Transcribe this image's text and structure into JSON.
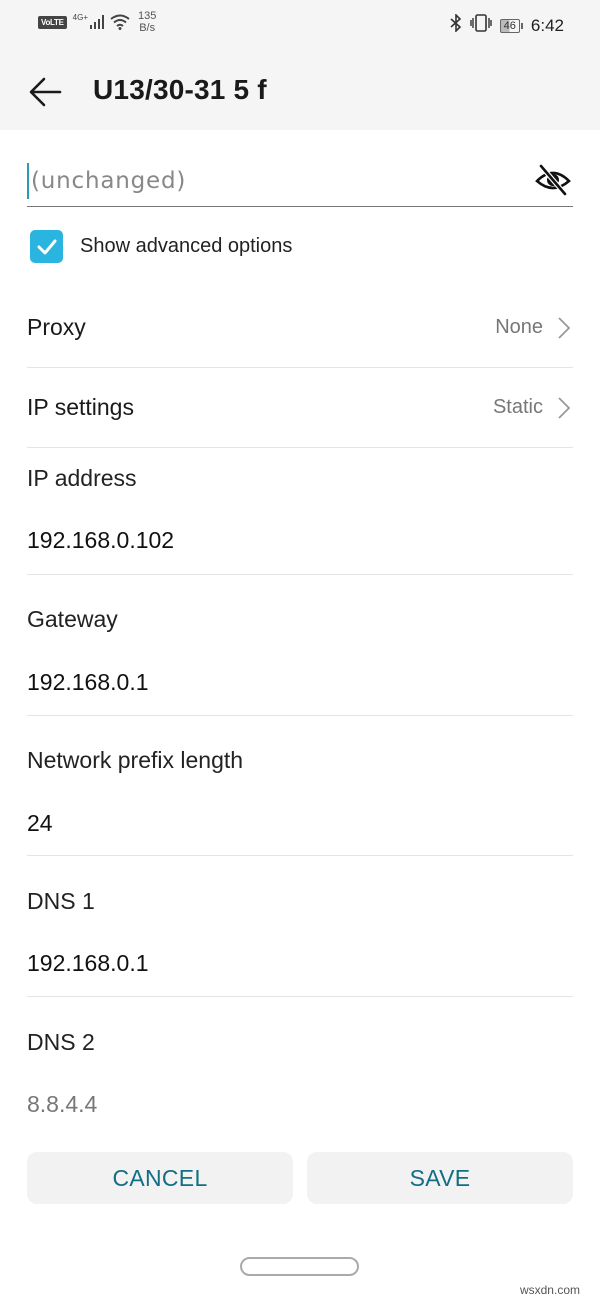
{
  "status_bar": {
    "volte": "VoLTE",
    "network_type": "4G+",
    "speed_value": "135",
    "speed_unit": "B/s",
    "battery_level": "46",
    "time": "6:42",
    "icons": [
      "volte-icon",
      "signal-icon",
      "wifi-icon",
      "bluetooth-icon",
      "vibrate-icon",
      "battery-icon"
    ]
  },
  "toolbar": {
    "back_icon": "arrow-left-icon",
    "title": "U13/30-31 5 f"
  },
  "password": {
    "placeholder": "(unchanged)",
    "value": "",
    "visibility_icon": "eye-off-icon"
  },
  "advanced": {
    "label": "Show advanced options",
    "checked": true
  },
  "settings": {
    "proxy": {
      "label": "Proxy",
      "value": "None"
    },
    "ip_settings": {
      "label": "IP settings",
      "value": "Static"
    }
  },
  "fields": {
    "ip_address": {
      "label": "IP address",
      "value": "192.168.0.102"
    },
    "gateway": {
      "label": "Gateway",
      "value": "192.168.0.1"
    },
    "prefix_length": {
      "label": "Network prefix length",
      "value": "24"
    },
    "dns1": {
      "label": "DNS 1",
      "value": "192.168.0.1"
    },
    "dns2": {
      "label": "DNS 2",
      "placeholder": "8.8.4.4"
    }
  },
  "buttons": {
    "cancel": "CANCEL",
    "save": "SAVE"
  },
  "colors": {
    "accent": "#2ab4e0",
    "button_text": "#126e85",
    "cursor": "#2a9bb4"
  },
  "watermark": "wsxdn.com"
}
